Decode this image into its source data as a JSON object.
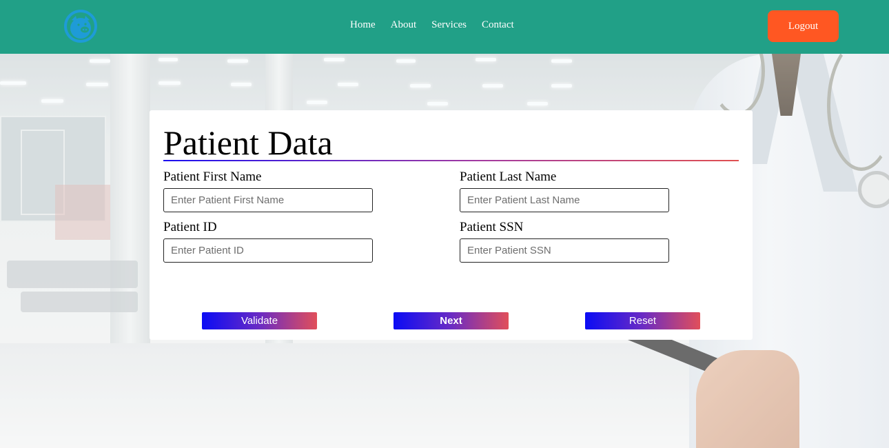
{
  "header": {
    "logo_icon": "pig-logo-icon",
    "nav": [
      {
        "label": "Home"
      },
      {
        "label": "About"
      },
      {
        "label": "Services"
      },
      {
        "label": "Contact"
      }
    ],
    "logout_label": "Logout"
  },
  "form": {
    "title": "Patient Data",
    "fields": [
      {
        "label": "Patient First Name",
        "placeholder": "Enter Patient First Name",
        "value": ""
      },
      {
        "label": "Patient Last Name",
        "placeholder": "Enter Patient Last Name",
        "value": ""
      },
      {
        "label": "Patient ID",
        "placeholder": "Enter Patient ID",
        "value": ""
      },
      {
        "label": "Patient SSN",
        "placeholder": "Enter Patient SSN",
        "value": ""
      }
    ],
    "buttons": {
      "validate": "Validate",
      "next": "Next",
      "reset": "Reset"
    }
  },
  "colors": {
    "header_bg": "#21a087",
    "logout_bg": "#ff5722",
    "logo": "#1e9bd7",
    "button_gradient_start": "#0b0cf4",
    "button_gradient_end": "#e14f5a"
  }
}
